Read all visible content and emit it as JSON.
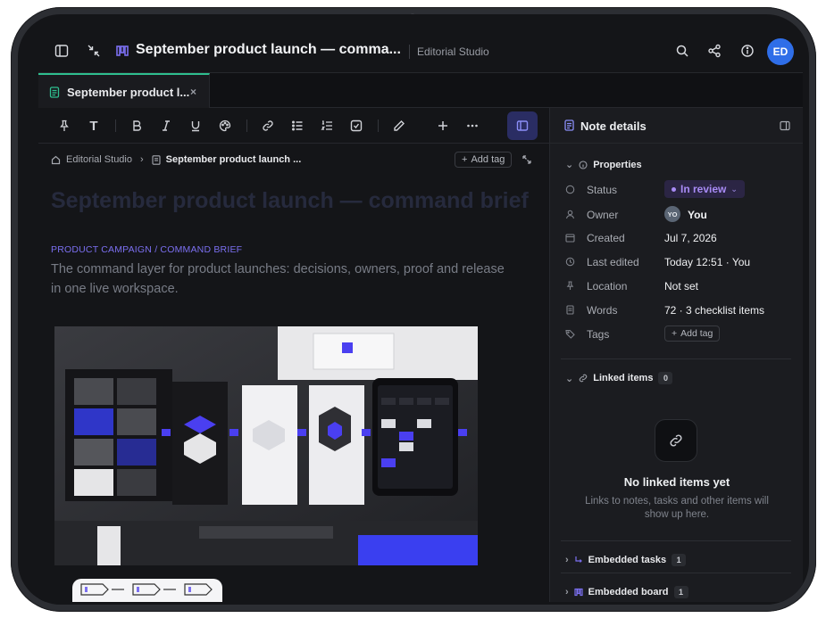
{
  "topbar": {
    "title": "September product launch — comma...",
    "workspace": "Editorial Studio",
    "avatar_initials": "ED",
    "icons": [
      "sidebar-toggle-icon",
      "collapse-icon",
      "board-icon",
      "search-icon",
      "share-icon",
      "info-icon"
    ]
  },
  "tabs": [
    {
      "label": "September product l...",
      "close": "×"
    }
  ],
  "toolbar": {
    "tools": [
      "pin",
      "text",
      "bold",
      "italic",
      "underline",
      "palette",
      "link",
      "bullet-list",
      "numbered-list",
      "checklist",
      "pen",
      "add",
      "more",
      "panel-toggle"
    ]
  },
  "breadcrumb": {
    "root": "Editorial Studio",
    "current": "September product launch ...",
    "add_tag": "Add tag"
  },
  "document": {
    "title": "September product launch — command brief",
    "kicker": "PRODUCT CAMPAIGN / COMMAND BRIEF",
    "lede": "The command layer for product launches: decisions, owners, proof and release in one live workspace."
  },
  "panel": {
    "title": "Note details",
    "properties_label": "Properties",
    "properties": {
      "status": {
        "label": "Status",
        "value": "In review"
      },
      "owner": {
        "label": "Owner",
        "initials": "YO",
        "value": "You"
      },
      "created": {
        "label": "Created",
        "value": "Jul 7, 2026"
      },
      "last_edited": {
        "label": "Last edited",
        "value": "Today 12:51 · You"
      },
      "location": {
        "label": "Location",
        "value": "Not set"
      },
      "words": {
        "label": "Words",
        "value": "72 · 3 checklist items"
      },
      "tags": {
        "label": "Tags",
        "value": "Add tag"
      }
    },
    "linked": {
      "label": "Linked items",
      "count": "0",
      "empty_title": "No linked items yet",
      "empty_desc": "Links to notes, tasks and other items will show up here."
    },
    "embedded_tasks": {
      "label": "Embedded tasks",
      "count": "1"
    },
    "embedded_board": {
      "label": "Embedded board",
      "count": "1"
    }
  },
  "colors": {
    "accent": "#7b6ff0",
    "tab_accent": "#2fbf8f",
    "avatar": "#2f6ee8",
    "status": "#a88bf5"
  }
}
